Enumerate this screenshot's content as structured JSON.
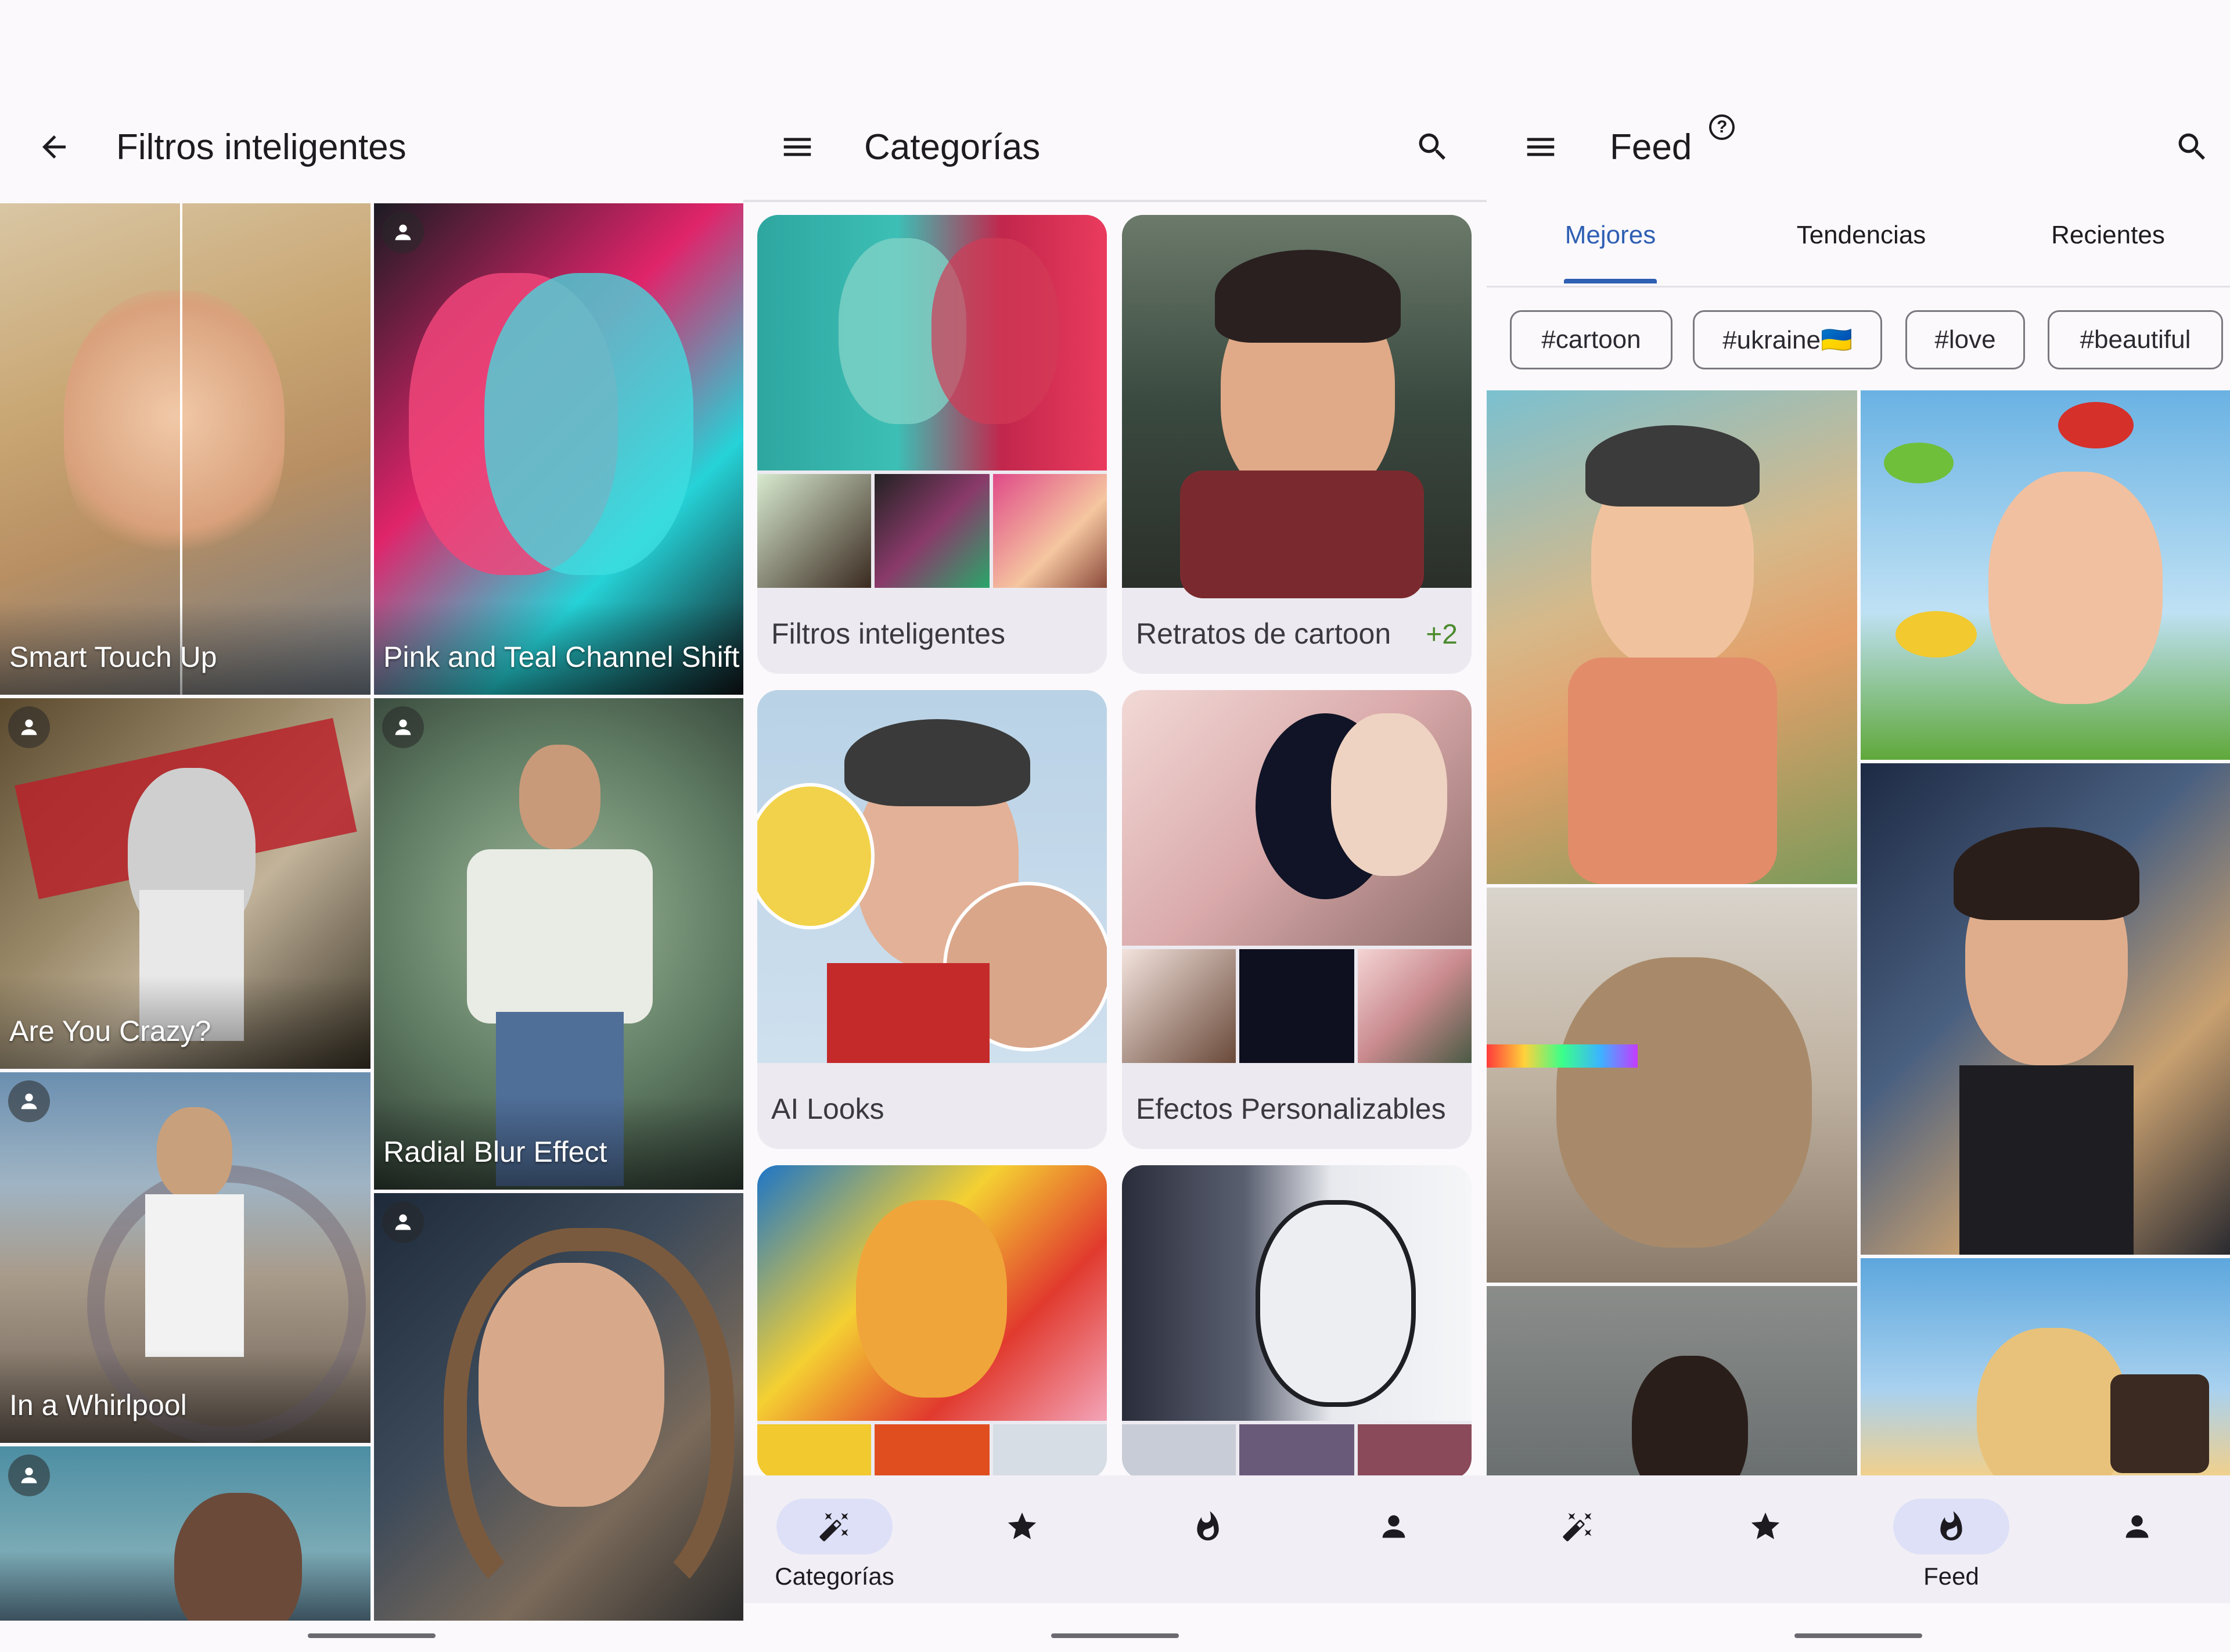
{
  "screens": {
    "smart_filters": {
      "title": "Filtros inteligentes",
      "tiles": [
        {
          "label": "Smart Touch Up"
        },
        {
          "label": "Pink and Teal Channel Shift"
        },
        {
          "label": "Are You Crazy?"
        },
        {
          "label": "Radial Blur Effect"
        },
        {
          "label": "In a Whirlpool"
        },
        {
          "label": ""
        },
        {
          "label": ""
        }
      ]
    },
    "categories": {
      "title": "Categorías",
      "cards": [
        {
          "label": "Filtros inteligentes",
          "extra": ""
        },
        {
          "label": "Retratos de cartoon",
          "extra": "+2"
        },
        {
          "label": "AI Looks",
          "extra": ""
        },
        {
          "label": "Efectos Personalizables",
          "extra": ""
        }
      ],
      "nav": [
        {
          "label": "Categorías",
          "icon": "magic-wand-icon",
          "active": true
        },
        {
          "label": "",
          "icon": "star-icon",
          "active": false
        },
        {
          "label": "",
          "icon": "flame-icon",
          "active": false
        },
        {
          "label": "",
          "icon": "person-icon",
          "active": false
        }
      ]
    },
    "feed": {
      "title": "Feed",
      "help_icon": "?",
      "tabs": [
        "Mejores",
        "Tendencias",
        "Recientes"
      ],
      "active_tab": "Mejores",
      "chips": [
        "#cartoon",
        "#ukraine🇺🇦",
        "#love",
        "#beautiful"
      ],
      "nav": [
        {
          "label": "",
          "icon": "magic-wand-icon",
          "active": false
        },
        {
          "label": "",
          "icon": "star-icon",
          "active": false
        },
        {
          "label": "Feed",
          "icon": "flame-icon",
          "active": true
        },
        {
          "label": "",
          "icon": "person-icon",
          "active": false
        }
      ]
    }
  },
  "colors": {
    "accent": "#2f5fb3",
    "active_pill": "#dde0f7",
    "extra_green": "#4c8a2e"
  }
}
